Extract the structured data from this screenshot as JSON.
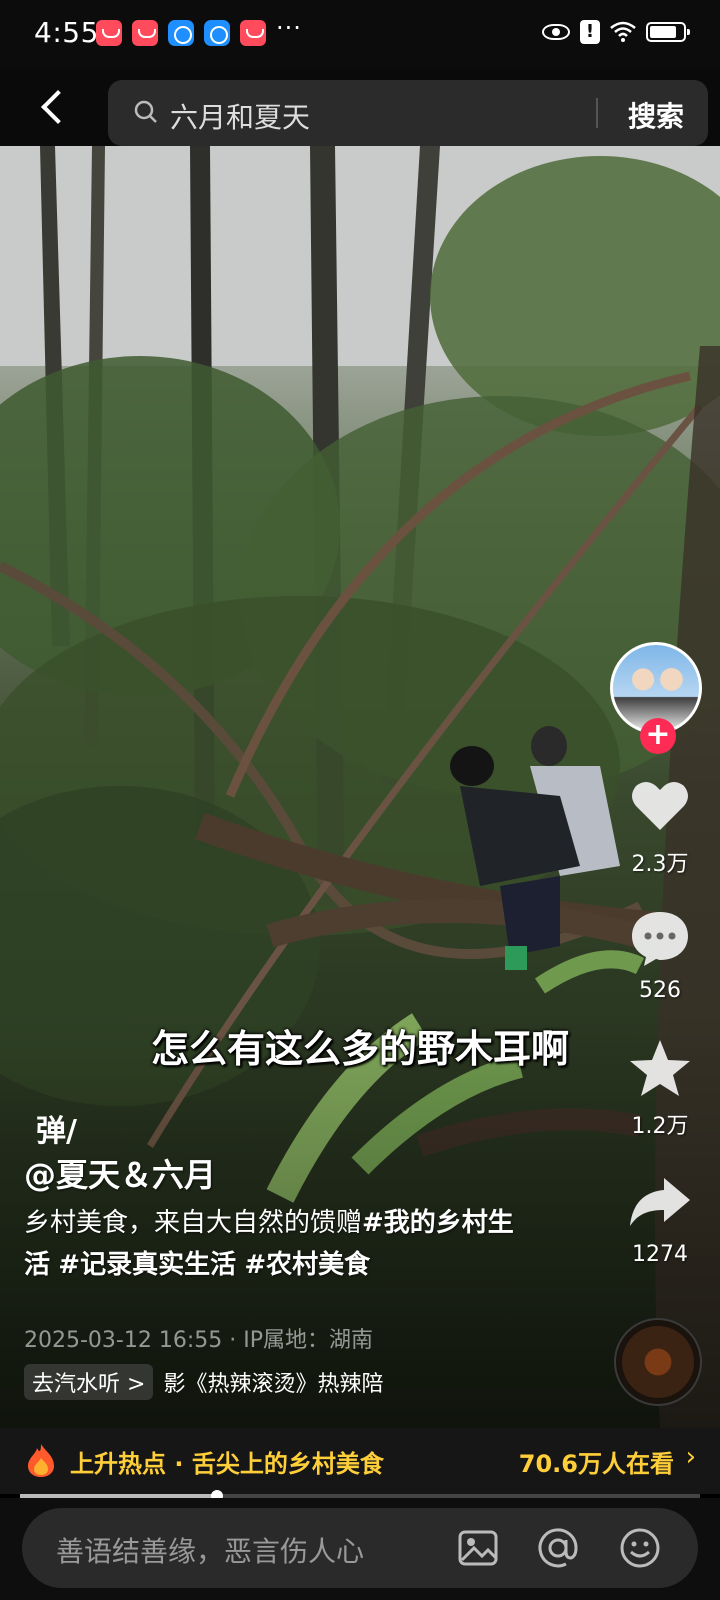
{
  "status_bar": {
    "time": "4:55",
    "more": "···"
  },
  "search": {
    "query": "六月和夏天",
    "button": "搜索"
  },
  "video": {
    "subtitle": "怎么有这么多的野木耳啊",
    "danmu_label": "弹",
    "author": "@夏天＆六月",
    "description_text": "乡村美食，来自大自然的馈赠",
    "tags": [
      "#我的乡村生活",
      "#记录真实生活",
      "#农村美食"
    ],
    "meta": "2025-03-12 16:55 · IP属地：湖南",
    "music_pill": "去汽水听 >",
    "music_text": "影《热辣滚烫》热辣陪"
  },
  "rail": {
    "likes": "2.3万",
    "comments": "526",
    "favorites": "1.2万",
    "shares": "1274",
    "follow_label": "+"
  },
  "hot": {
    "text": "上升热点 · 舌尖上的乡村美食",
    "count": "70.6万人在看",
    "arrow": "›"
  },
  "progress": {
    "fraction": 0.29
  },
  "comment": {
    "placeholder": "善语结善缘，恶言伤人心"
  },
  "colors": {
    "accent_red": "#fe2c55",
    "hot_yellow": "#ffcf3a"
  },
  "icons": [
    "back-icon",
    "search-icon",
    "heart-icon",
    "comment-icon",
    "star-icon",
    "share-icon",
    "flame-icon",
    "image-icon",
    "at-icon",
    "emoji-icon"
  ]
}
